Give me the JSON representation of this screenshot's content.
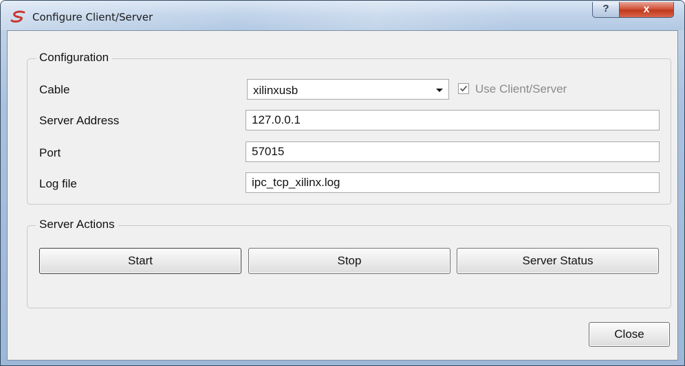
{
  "window": {
    "title": "Configure Client/Server",
    "help_glyph": "?",
    "close_glyph": "x"
  },
  "configuration": {
    "title": "Configuration",
    "cable_label": "Cable",
    "cable_value": "xilinxusb",
    "use_client_server_label": "Use Client/Server",
    "use_client_server_checked": true,
    "server_address_label": "Server Address",
    "server_address_value": "127.0.0.1",
    "port_label": "Port",
    "port_value": "57015",
    "log_file_label": "Log file",
    "log_file_value": "ipc_tcp_xilinx.log"
  },
  "server_actions": {
    "title": "Server Actions",
    "start_label": "Start",
    "stop_label": "Stop",
    "status_label": "Server Status"
  },
  "footer": {
    "close_label": "Close"
  },
  "icons": {
    "app": "app-logo-icon",
    "dropdown": "dropdown-arrow-icon",
    "checkmark": "checkmark-icon"
  },
  "colors": {
    "app_logo": "#c7362f",
    "close_button": "#c7452a",
    "client_background": "#f0f0f0"
  }
}
